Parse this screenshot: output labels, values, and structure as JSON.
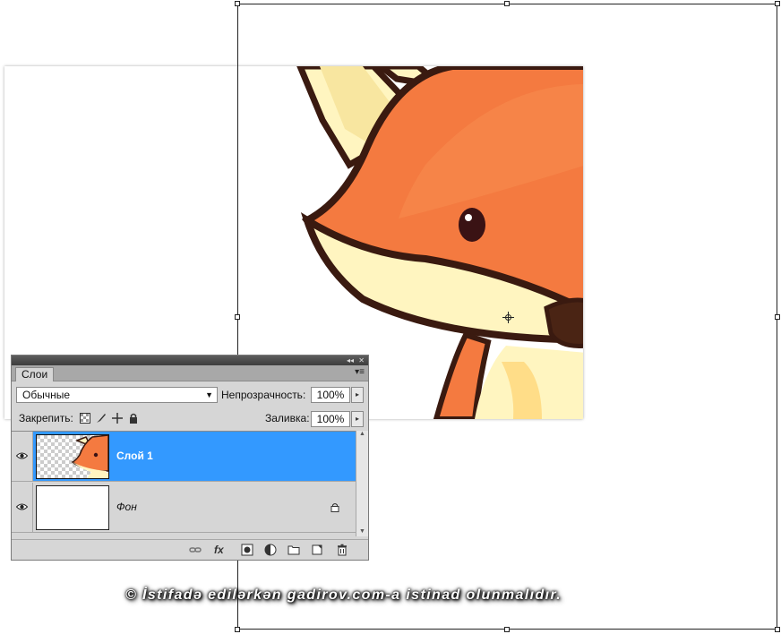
{
  "panel": {
    "tab_label": "Слои",
    "blend_mode": "Обычные",
    "opacity_label": "Непрозрачность:",
    "opacity_value": "100%",
    "lock_label": "Закрепить:",
    "fill_label": "Заливка:",
    "fill_value": "100%",
    "layers": [
      {
        "name": "Слой 1",
        "selected": true,
        "visible": true
      },
      {
        "name": "Фон",
        "selected": false,
        "visible": true,
        "locked": true
      }
    ]
  },
  "colors": {
    "selection": "#3399ff",
    "panel_bg": "#d6d6d6",
    "fox_orange": "#f47a40",
    "fox_cream": "#fff5c0",
    "fox_outline": "#3a1a10"
  },
  "watermark": "© İstifadə edilərkən gadirov.com-a istinad olunmalıdır."
}
